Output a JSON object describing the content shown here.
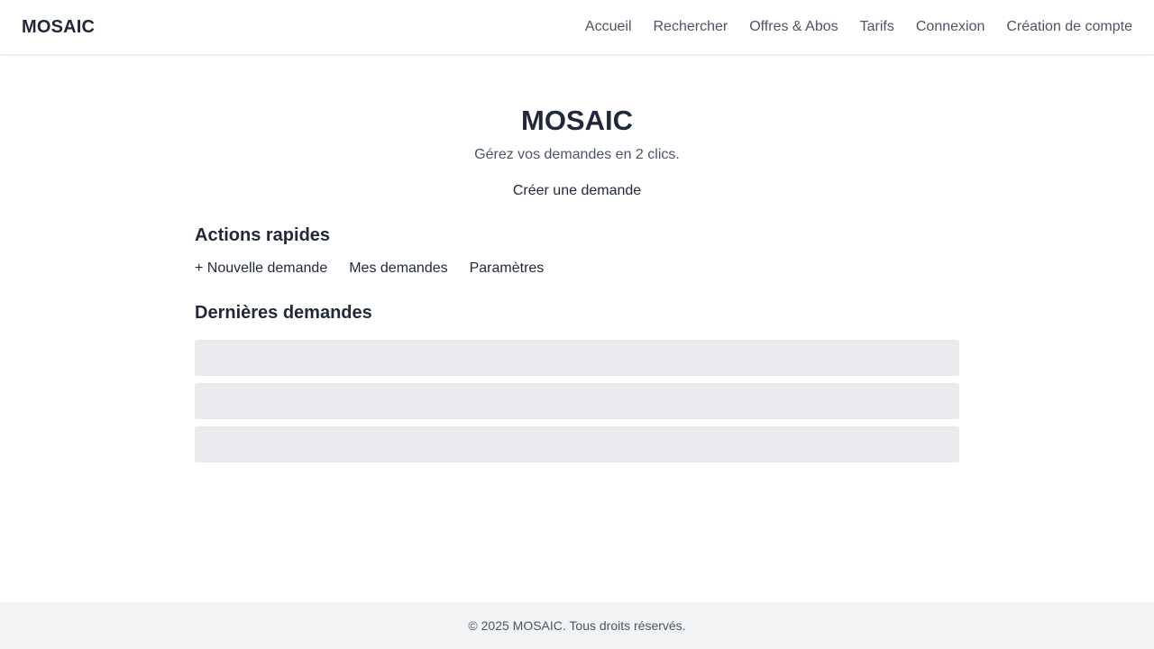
{
  "header": {
    "brand": "MOSAIC",
    "nav": [
      {
        "label": "Accueil"
      },
      {
        "label": "Rechercher"
      },
      {
        "label": "Offres & Abos"
      },
      {
        "label": "Tarifs"
      },
      {
        "label": "Connexion"
      },
      {
        "label": "Création de compte"
      }
    ]
  },
  "hero": {
    "title": "MOSAIC",
    "subtitle": "Gérez vos demandes en 2 clics.",
    "cta": "Créer une demande"
  },
  "quick_actions": {
    "title": "Actions rapides",
    "items": [
      {
        "label": "+ Nouvelle demande"
      },
      {
        "label": "Mes demandes"
      },
      {
        "label": "Paramètres"
      }
    ]
  },
  "recent": {
    "title": "Dernières demandes"
  },
  "footer": {
    "text": "© 2025 MOSAIC. Tous droits réservés."
  },
  "colors": {
    "placeholder": "#e9eaee",
    "footer_bg": "#f2f3f5",
    "text_primary": "#1f2937",
    "text_muted": "#4b5563"
  }
}
